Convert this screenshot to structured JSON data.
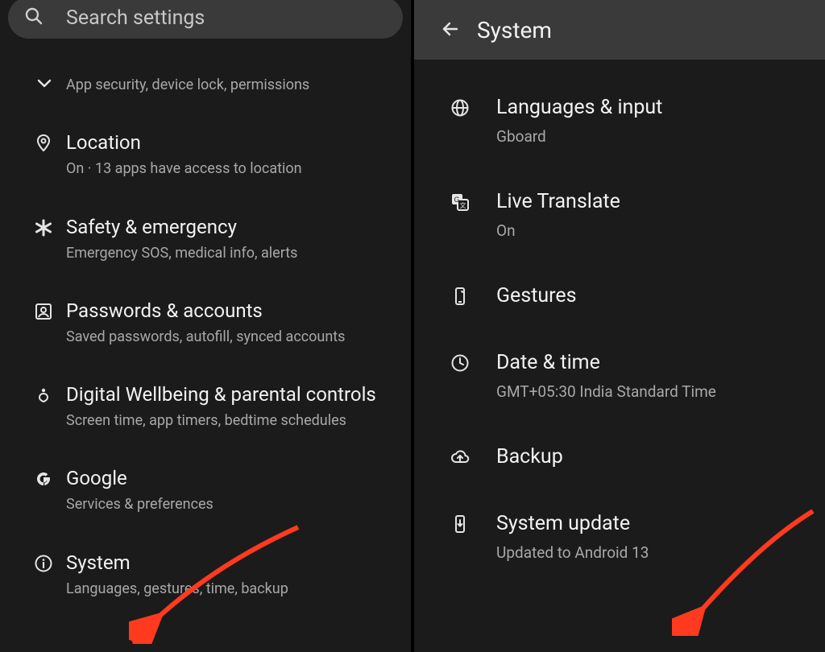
{
  "left": {
    "search_placeholder": "Search settings",
    "items": [
      {
        "icon": "chevron-down",
        "title": "",
        "subtitle": "App security, device lock, permissions"
      },
      {
        "icon": "location-pin",
        "title": "Location",
        "subtitle": "On · 13 apps have access to location"
      },
      {
        "icon": "asterisk",
        "title": "Safety & emergency",
        "subtitle": "Emergency SOS, medical info, alerts"
      },
      {
        "icon": "account-box",
        "title": "Passwords & accounts",
        "subtitle": "Saved passwords, autofill, synced accounts"
      },
      {
        "icon": "wellbeing",
        "title": "Digital Wellbeing & parental controls",
        "subtitle": "Screen time, app timers, bedtime schedules"
      },
      {
        "icon": "google-g",
        "title": "Google",
        "subtitle": "Services & preferences"
      },
      {
        "icon": "info",
        "title": "System",
        "subtitle": "Languages, gestures, time, backup"
      }
    ]
  },
  "right": {
    "appbar_title": "System",
    "items": [
      {
        "icon": "globe",
        "title": "Languages & input",
        "subtitle": "Gboard"
      },
      {
        "icon": "translate",
        "title": "Live Translate",
        "subtitle": "On"
      },
      {
        "icon": "phone-gesture",
        "title": "Gestures",
        "subtitle": ""
      },
      {
        "icon": "clock",
        "title": "Date & time",
        "subtitle": "GMT+05:30 India Standard Time"
      },
      {
        "icon": "cloud-upload",
        "title": "Backup",
        "subtitle": ""
      },
      {
        "icon": "phone-download",
        "title": "System update",
        "subtitle": "Updated to Android 13"
      }
    ]
  },
  "annotations": {
    "arrow_color": "#ff3a1f"
  }
}
